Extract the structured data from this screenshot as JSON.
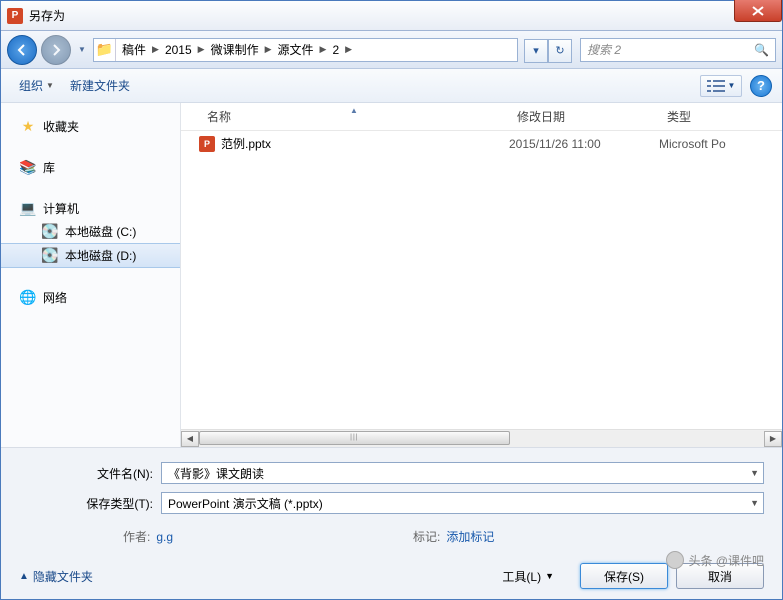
{
  "window": {
    "title": "另存为"
  },
  "nav": {
    "breadcrumb": [
      "稿件",
      "2015",
      "微课制作",
      "源文件",
      "2"
    ],
    "search_placeholder": "搜索 2"
  },
  "toolbar": {
    "organize": "组织",
    "new_folder": "新建文件夹"
  },
  "sidebar": {
    "favorites": "收藏夹",
    "libraries": "库",
    "computer": "计算机",
    "disk_c": "本地磁盘 (C:)",
    "disk_d": "本地磁盘 (D:)",
    "network": "网络"
  },
  "columns": {
    "name": "名称",
    "date": "修改日期",
    "type": "类型"
  },
  "files": [
    {
      "name": "范例.pptx",
      "date": "2015/11/26 11:00",
      "type": "Microsoft Po"
    }
  ],
  "form": {
    "filename_label": "文件名(N):",
    "filename_value": "《背影》课文朗读",
    "filetype_label": "保存类型(T):",
    "filetype_value": "PowerPoint 演示文稿 (*.pptx)",
    "author_label": "作者:",
    "author_value": "g.g",
    "tags_label": "标记:",
    "tags_value": "添加标记"
  },
  "footer": {
    "hide_folders": "隐藏文件夹",
    "tools": "工具(L)",
    "save": "保存(S)",
    "cancel": "取消"
  },
  "watermark": "头条 @课件吧"
}
